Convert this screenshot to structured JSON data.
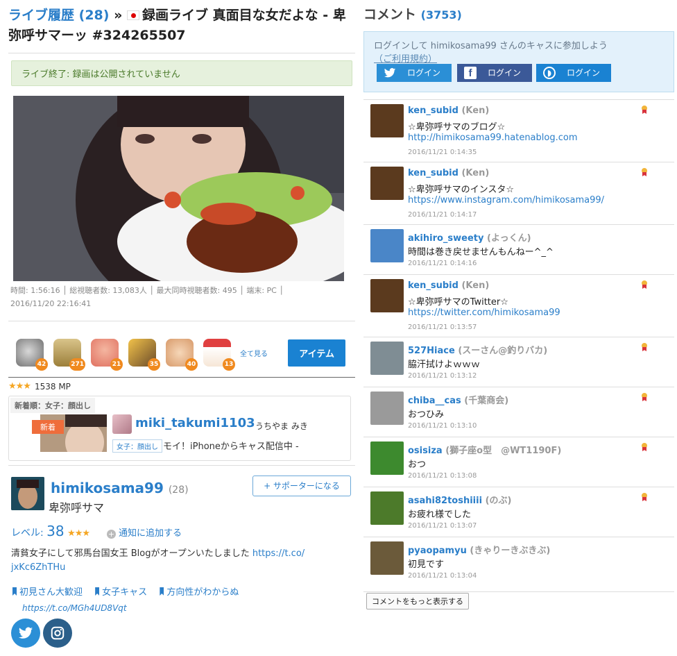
{
  "header": {
    "history_label": "ライブ履歴",
    "history_count": "(28)",
    "sep": "»",
    "title": "録画ライブ 真面目な女だよな - 卑弥呼サマーッ #324265507"
  },
  "notice": "ライブ終了: 録画は公開されていません",
  "stats": {
    "line1": "時間: 1:56:16 │ 総視聴者数: 13,083人 │ 最大同時視聴者数: 495 │ 端末: PC │",
    "line2": "2016/11/20 22:16:41"
  },
  "items": {
    "counts": [
      "42",
      "271",
      "21",
      "35",
      "40",
      "13"
    ],
    "icons": [
      "coin-icon",
      "tea-icon",
      "peach-icon",
      "party-popper-icon",
      "clap-icon",
      "cake-icon"
    ],
    "see_all": "全て見る",
    "button": "アイテム"
  },
  "mp": {
    "stars": "★★★",
    "value": "1538 MP"
  },
  "new_live": {
    "tag": "新着順：女子：顔出し",
    "label": "新着",
    "user": "miki_takumi1103",
    "display": "うちやま みき",
    "category": "女子：顔出し",
    "title": "モイ！iPhoneからキャス配信中 -"
  },
  "profile": {
    "name": "himikosama99",
    "count": "(28)",
    "display": "卑弥呼サマ",
    "support_btn": "+ サポーターになる",
    "level_label": "レベル:",
    "level": "38",
    "level_stars": "★★★",
    "notify": "通知に追加する",
    "bio": "清貧女子にして邪馬台国女王 Blogがオープンいたしました ",
    "bio_link1": "https://t.co/",
    "bio_link2": "jxKc6ZhTHu",
    "tags": [
      "初見さん大歓迎",
      "女子キャス",
      "方向性がわからぬ"
    ],
    "link": "https://t.co/MGh4UD8Vqt"
  },
  "comments_header": {
    "label": "コメント",
    "count": "(3753)"
  },
  "login": {
    "line1": "ログインして himikosama99 さんのキャスに参加しよう",
    "terms": "（ご利用規約）",
    "twitter": "ログイン",
    "facebook": "ログイン",
    "twitcasting": "ログイン"
  },
  "comments": [
    {
      "user": "ken_subid",
      "name": "(Ken)",
      "text": "☆卑弥呼サマのブログ☆",
      "link": "http://himikosama99.hatenablog.com",
      "time": "2016/11/21 0:14:35",
      "badge": true,
      "av": "#5b3a1e"
    },
    {
      "user": "ken_subid",
      "name": "(Ken)",
      "text": "☆卑弥呼サマのインスタ☆",
      "link": "https://www.instagram.com/himikosama99/",
      "time": "2016/11/21 0:14:17",
      "badge": true,
      "av": "#5b3a1e"
    },
    {
      "user": "akihiro_sweety",
      "name": "(よっくん)",
      "text": "時間は巻き戻せませんもんねー^_^",
      "link": "",
      "time": "2016/11/21 0:14:16",
      "badge": false,
      "av": "#4a86c8"
    },
    {
      "user": "ken_subid",
      "name": "(Ken)",
      "text": "☆卑弥呼サマのTwitter☆",
      "link": "https://twitter.com/himikosama99",
      "time": "2016/11/21 0:13:57",
      "badge": true,
      "av": "#5b3a1e"
    },
    {
      "user": "527Hiace",
      "name": "(スーさん@釣りバカ)",
      "text": "脇汗拭けよｗｗｗ",
      "link": "",
      "time": "2016/11/21 0:13:12",
      "badge": true,
      "av": "#7f8d94"
    },
    {
      "user": "chiba__cas",
      "name": "(千葉商会)",
      "text": "おつひみ",
      "link": "",
      "time": "2016/11/21 0:13:10",
      "badge": true,
      "av": "#9a9a9a"
    },
    {
      "user": "osisiza",
      "name": "(獅子座o型　@WT1190F)",
      "text": "おつ",
      "link": "",
      "time": "2016/11/21 0:13:08",
      "badge": true,
      "av": "#3d8a2e"
    },
    {
      "user": "asahi82toshiiii",
      "name": "(のぶ)",
      "text": "お疲れ様でした",
      "link": "",
      "time": "2016/11/21 0:13:07",
      "badge": true,
      "av": "#4c7a2a"
    },
    {
      "user": "pyaopamyu",
      "name": "(きゃりーきぶきぶ)",
      "text": "初見です",
      "link": "",
      "time": "2016/11/21 0:13:04",
      "badge": false,
      "av": "#6b5a3a"
    }
  ],
  "more_button": "コメントをもっと表示する"
}
